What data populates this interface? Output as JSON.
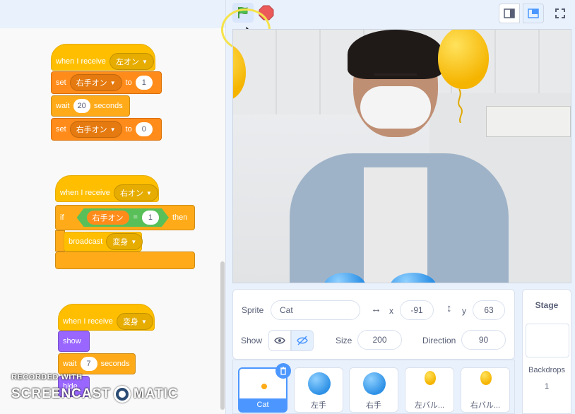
{
  "code": {
    "script1": {
      "hat_label": "when I receive",
      "hat_message": "左オン",
      "set1_label": "set",
      "set1_var": "右手オン",
      "set1_to": "to",
      "set1_value": "1",
      "wait_label": "wait",
      "wait_value": "20",
      "wait_unit": "seconds",
      "set2_label": "set",
      "set2_var": "右手オン",
      "set2_to": "to",
      "set2_value": "0"
    },
    "script2": {
      "hat_label": "when I receive",
      "hat_message": "右オン",
      "if_label": "if",
      "cond_var": "右手オン",
      "cond_op": "=",
      "cond_value": "1",
      "then_label": "then",
      "broadcast_label": "broadcast",
      "broadcast_message": "変身"
    },
    "script3": {
      "hat_label": "when I receive",
      "hat_message": "変身",
      "show_label": "show",
      "wait_label": "wait",
      "wait_value": "7",
      "wait_unit": "seconds",
      "hide_label": "hide"
    }
  },
  "header": {
    "green_flag_icon": "green-flag-icon",
    "stop_icon": "stop-icon",
    "view_buttons": [
      "small-stage-icon",
      "large-stage-icon",
      "fullscreen-icon"
    ]
  },
  "sprite_info": {
    "sprite_label": "Sprite",
    "sprite_name": "Cat",
    "x_label": "x",
    "x_value": "-91",
    "y_label": "y",
    "y_value": "63",
    "show_label": "Show",
    "size_label": "Size",
    "size_value": "200",
    "direction_label": "Direction",
    "direction_value": "90"
  },
  "sprites": [
    {
      "name": "Cat",
      "selected": true
    },
    {
      "name": "左手",
      "selected": false
    },
    {
      "name": "右手",
      "selected": false
    },
    {
      "name": "左バル...",
      "selected": false
    },
    {
      "name": "右バル...",
      "selected": false
    }
  ],
  "stage_pane": {
    "title": "Stage",
    "backdrops_label": "Backdrops",
    "backdrops_count": "1"
  },
  "watermark": {
    "line1": "RECORDED WITH",
    "line2a": "SCREENCAST",
    "line2b": "MATIC"
  },
  "colors": {
    "events": "#ffbf00",
    "variables": "#ff8c1a",
    "control": "#ffab19",
    "looks": "#9966ff",
    "operators": "#59c059",
    "accent": "#4c97ff"
  }
}
